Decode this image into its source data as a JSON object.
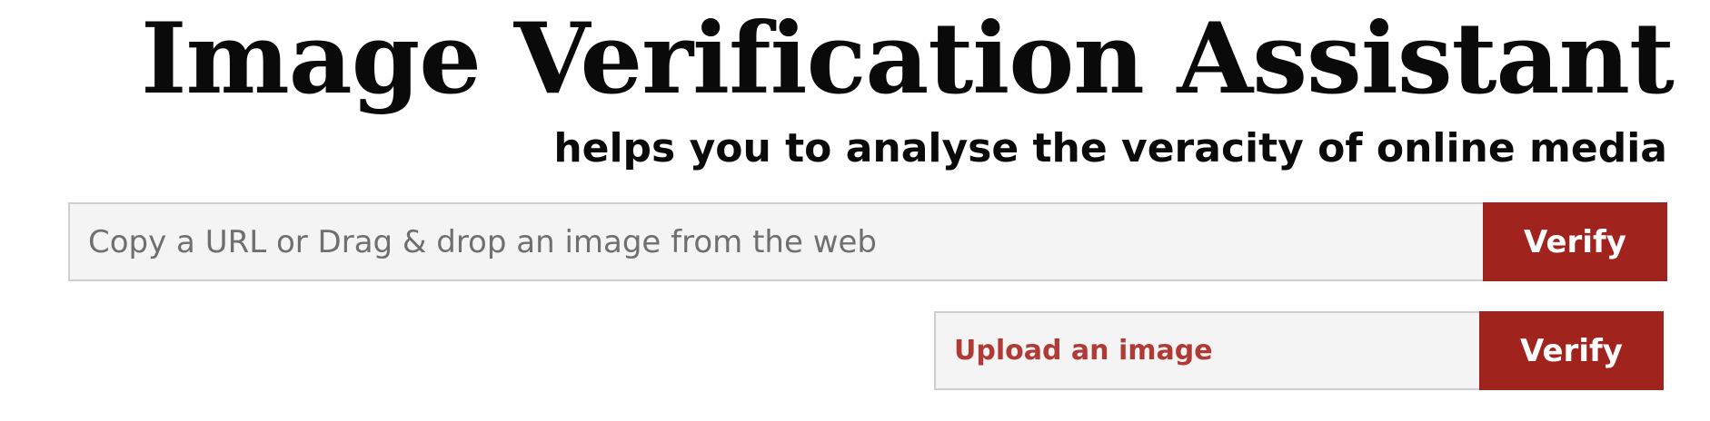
{
  "header": {
    "title": "Image Verification Assistant",
    "subtitle": "helps you to analyse the veracity of online media"
  },
  "url_form": {
    "placeholder": "Copy a URL or Drag & drop an image from the web",
    "value": "",
    "button_label": "Verify"
  },
  "upload_form": {
    "label": "Upload an image",
    "button_label": "Verify"
  },
  "colors": {
    "accent": "#a0231e",
    "upload_text": "#b03a36",
    "field_background": "#f4f4f4",
    "field_border": "#cfcfcf"
  }
}
